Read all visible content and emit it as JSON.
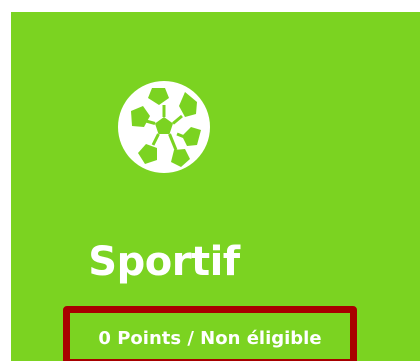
{
  "card": {
    "title": "Sportif",
    "status": "0 Points / Non éligible",
    "icon": "soccer-ball-icon",
    "background_color": "#7bd321",
    "highlight_color": "#a80000"
  }
}
